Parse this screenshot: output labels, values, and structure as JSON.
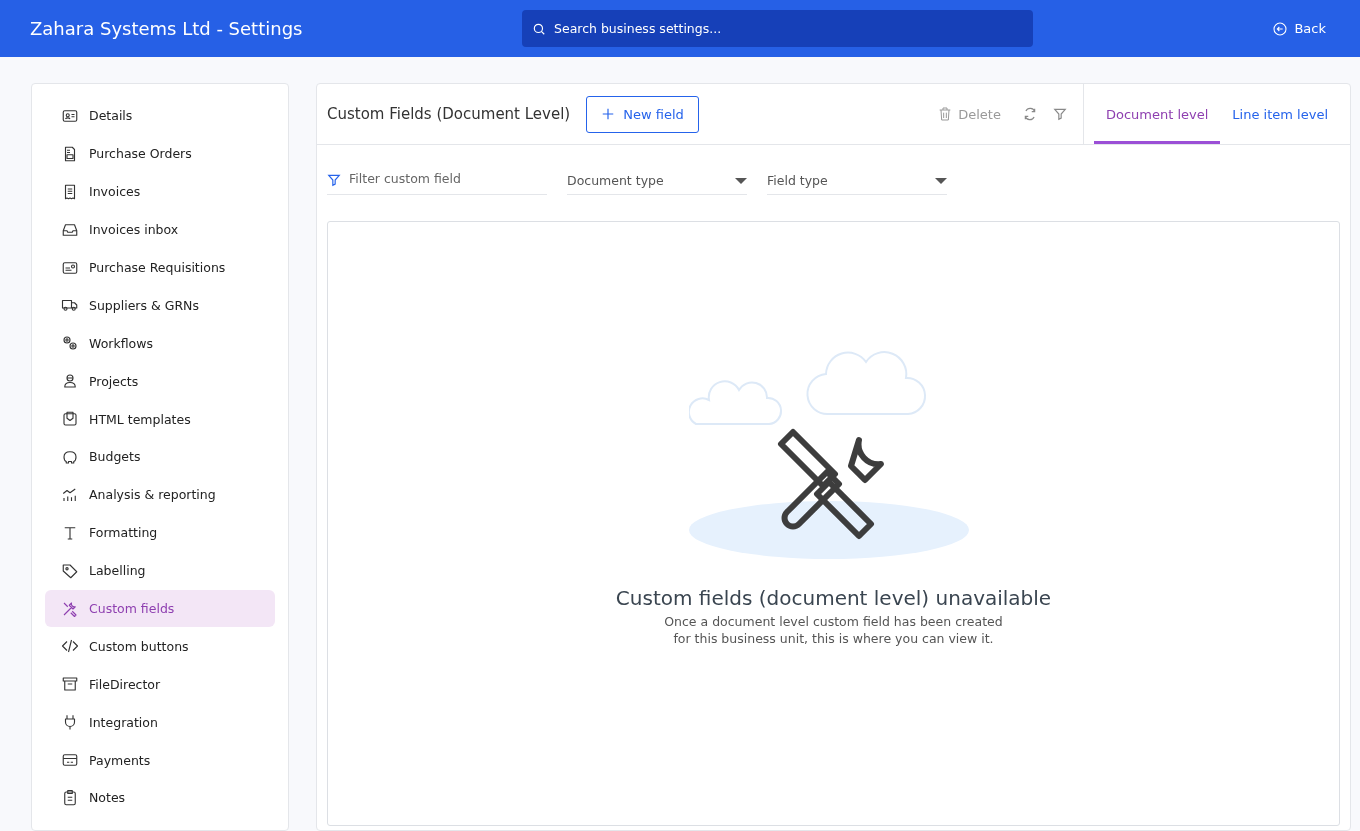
{
  "header": {
    "title": "Zahara Systems Ltd - Settings",
    "search": {
      "placeholder": "Search business settings..."
    },
    "back_label": "Back"
  },
  "sidebar": {
    "items": [
      {
        "label": "Details",
        "selected": false
      },
      {
        "label": "Purchase Orders",
        "selected": false
      },
      {
        "label": "Invoices",
        "selected": false
      },
      {
        "label": "Invoices inbox",
        "selected": false
      },
      {
        "label": "Purchase Requisitions",
        "selected": false
      },
      {
        "label": "Suppliers & GRNs",
        "selected": false
      },
      {
        "label": "Workflows",
        "selected": false
      },
      {
        "label": "Projects",
        "selected": false
      },
      {
        "label": "HTML templates",
        "selected": false
      },
      {
        "label": "Budgets",
        "selected": false
      },
      {
        "label": "Analysis & reporting",
        "selected": false
      },
      {
        "label": "Formatting",
        "selected": false
      },
      {
        "label": "Labelling",
        "selected": false
      },
      {
        "label": "Custom fields",
        "selected": true
      },
      {
        "label": "Custom buttons",
        "selected": false
      },
      {
        "label": "FileDirector",
        "selected": false
      },
      {
        "label": "Integration",
        "selected": false
      },
      {
        "label": "Payments",
        "selected": false
      },
      {
        "label": "Notes",
        "selected": false
      }
    ]
  },
  "panel": {
    "title": "Custom Fields (Document Level)",
    "new_button": "New field",
    "delete_button": {
      "label": "Delete",
      "disabled": true
    },
    "tabs": [
      {
        "label": "Document level",
        "selected": true
      },
      {
        "label": "Line item level",
        "selected": false
      }
    ],
    "filters": [
      {
        "kind": "search",
        "placeholder": "Filter custom field"
      },
      {
        "kind": "dropdown",
        "placeholder": "Document type"
      },
      {
        "kind": "dropdown",
        "placeholder": "Field type"
      }
    ],
    "empty_state": {
      "title": "Custom fields (document level) unavailable",
      "lines": [
        "Once a document level custom field has been created",
        "for this business unit, this is where you can view it."
      ]
    }
  }
}
